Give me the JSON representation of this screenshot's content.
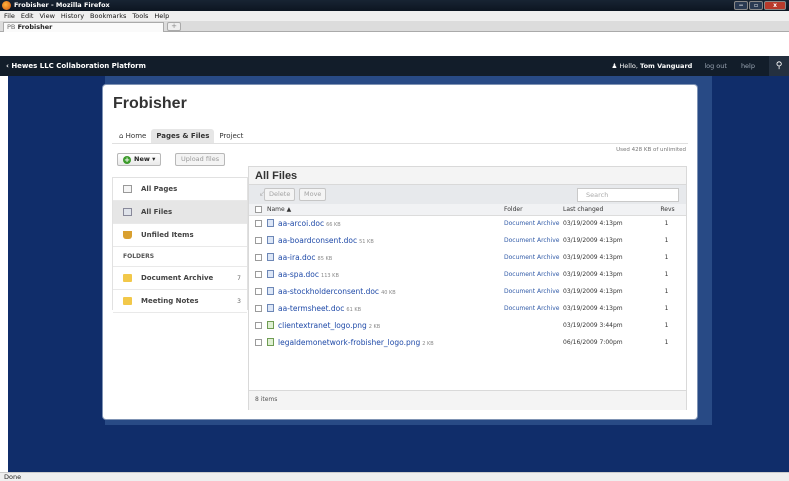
{
  "browser": {
    "title": "Frobisher - Mozilla Firefox",
    "menu": [
      "File",
      "Edit",
      "View",
      "History",
      "Bookmarks",
      "Tools",
      "Help"
    ],
    "tab_favicon": "PB",
    "tab_label": "Frobisher",
    "new_tab": "+",
    "window_buttons": [
      "−",
      "▫",
      "x"
    ],
    "status": "Done"
  },
  "appbar": {
    "home_label": "‹ Hewes LLC Collaboration Platform",
    "greeting": "Hello, ",
    "user_name": "Tom Vanguard",
    "logout": "log out",
    "help": "help",
    "search_icon": "search-icon"
  },
  "page": {
    "title": "Frobisher",
    "nav": {
      "home": "Home",
      "pages_files": "Pages & Files",
      "project": "Project"
    },
    "new_button": "New ▾",
    "upload_button": "Upload files",
    "quota": "Used 428 KB of unlimited"
  },
  "sidebar": {
    "items": [
      {
        "label": "All Pages",
        "icon": "page-icon"
      },
      {
        "label": "All Files",
        "icon": "files-icon"
      },
      {
        "label": "Unfiled Items",
        "icon": "tray-icon"
      }
    ],
    "folders_header": "FOLDERS",
    "folders": [
      {
        "label": "Document Archive",
        "count": "7",
        "icon": "folder-icon"
      },
      {
        "label": "Meeting Notes",
        "count": "3",
        "icon": "folder-icon"
      }
    ]
  },
  "files": {
    "heading": "All Files",
    "delete_button": "Delete",
    "move_button": "Move",
    "search_placeholder": "Search",
    "columns": {
      "name": "Name ▲",
      "folder": "Folder",
      "changed": "Last changed",
      "revs": "Revs"
    },
    "rows": [
      {
        "name": "aa-arcoi.doc",
        "size": "66 KB",
        "folder": "Document Archive",
        "changed": "03/19/2009 4:13pm",
        "revs": "1",
        "type": "doc"
      },
      {
        "name": "aa-boardconsent.doc",
        "size": "51 KB",
        "folder": "Document Archive",
        "changed": "03/19/2009 4:13pm",
        "revs": "1",
        "type": "doc"
      },
      {
        "name": "aa-ira.doc",
        "size": "85 KB",
        "folder": "Document Archive",
        "changed": "03/19/2009 4:13pm",
        "revs": "1",
        "type": "doc"
      },
      {
        "name": "aa-spa.doc",
        "size": "113 KB",
        "folder": "Document Archive",
        "changed": "03/19/2009 4:13pm",
        "revs": "1",
        "type": "doc"
      },
      {
        "name": "aa-stockholderconsent.doc",
        "size": "40 KB",
        "folder": "Document Archive",
        "changed": "03/19/2009 4:13pm",
        "revs": "1",
        "type": "doc"
      },
      {
        "name": "aa-termsheet.doc",
        "size": "61 KB",
        "folder": "Document Archive",
        "changed": "03/19/2009 4:13pm",
        "revs": "1",
        "type": "doc"
      },
      {
        "name": "clientextranet_logo.png",
        "size": "2 KB",
        "folder": "",
        "changed": "03/19/2009 3:44pm",
        "revs": "1",
        "type": "png"
      },
      {
        "name": "legaldemonetwork-frobisher_logo.png",
        "size": "2 KB",
        "folder": "",
        "changed": "06/16/2009 7:00pm",
        "revs": "1",
        "type": "png"
      }
    ],
    "footer": "8 items"
  }
}
